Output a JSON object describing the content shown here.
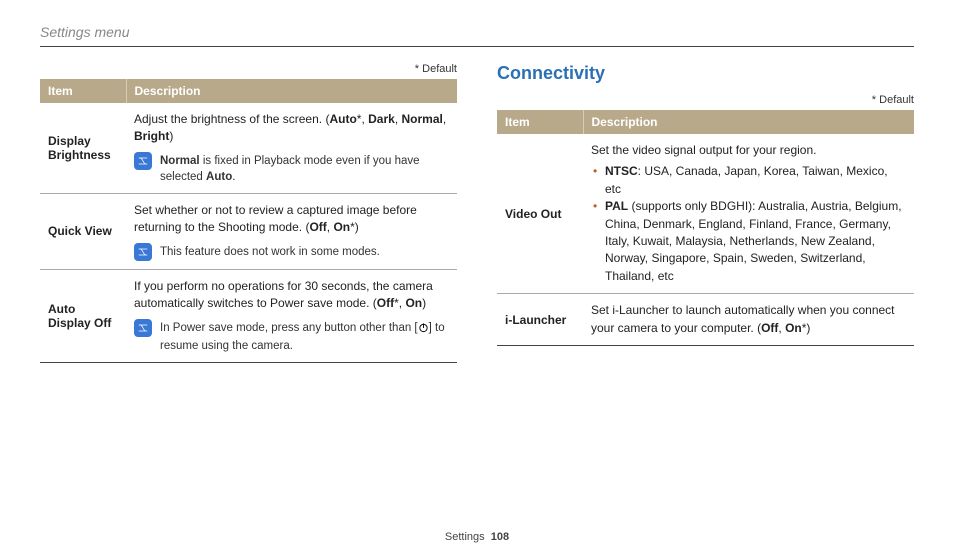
{
  "breadcrumb": "Settings menu",
  "default_note": "* Default",
  "left_table": {
    "headers": {
      "item": "Item",
      "description": "Description"
    },
    "rows": [
      {
        "item": "Display Brightness",
        "desc_html": "Adjust the brightness of the screen. (<b>Auto</b>*, <b>Dark</b>, <b>Normal</b>, <b>Bright</b>)",
        "note_html": "<b>Normal</b> is fixed in Playback mode even if you have selected <b>Auto</b>."
      },
      {
        "item": "Quick View",
        "desc_html": "Set whether or not to review a captured image before returning to the Shooting mode. (<b>Off</b>, <b>On</b>*)",
        "note_html": "This feature does not work in some modes."
      },
      {
        "item": "Auto Display Off",
        "desc_html": "If you perform no operations for 30 seconds, the camera automatically switches to Power save mode. (<b>Off</b>*, <b>On</b>)",
        "note_power_pre": "In Power save mode, press any button other than [",
        "note_power_post": "] to resume using the camera."
      }
    ]
  },
  "right_section_title": "Connectivity",
  "right_table": {
    "headers": {
      "item": "Item",
      "description": "Description"
    },
    "rows": [
      {
        "item": "Video Out",
        "desc_html": "Set the video signal output for your region.",
        "bullets": [
          "<b>NTSC</b>: USA, Canada, Japan, Korea, Taiwan, Mexico, etc",
          "<b>PAL</b> (supports only BDGHI): Australia, Austria, Belgium, China, Denmark, England, Finland, France, Germany, Italy, Kuwait, Malaysia, Netherlands, New Zealand, Norway, Singapore, Spain, Sweden, Switzerland, Thailand, etc"
        ]
      },
      {
        "item": "i-Launcher",
        "desc_html": "Set i-Launcher to launch automatically when you connect your camera to your computer. (<b>Off</b>, <b>On</b>*)"
      }
    ]
  },
  "footer": {
    "section": "Settings",
    "page": "108"
  }
}
